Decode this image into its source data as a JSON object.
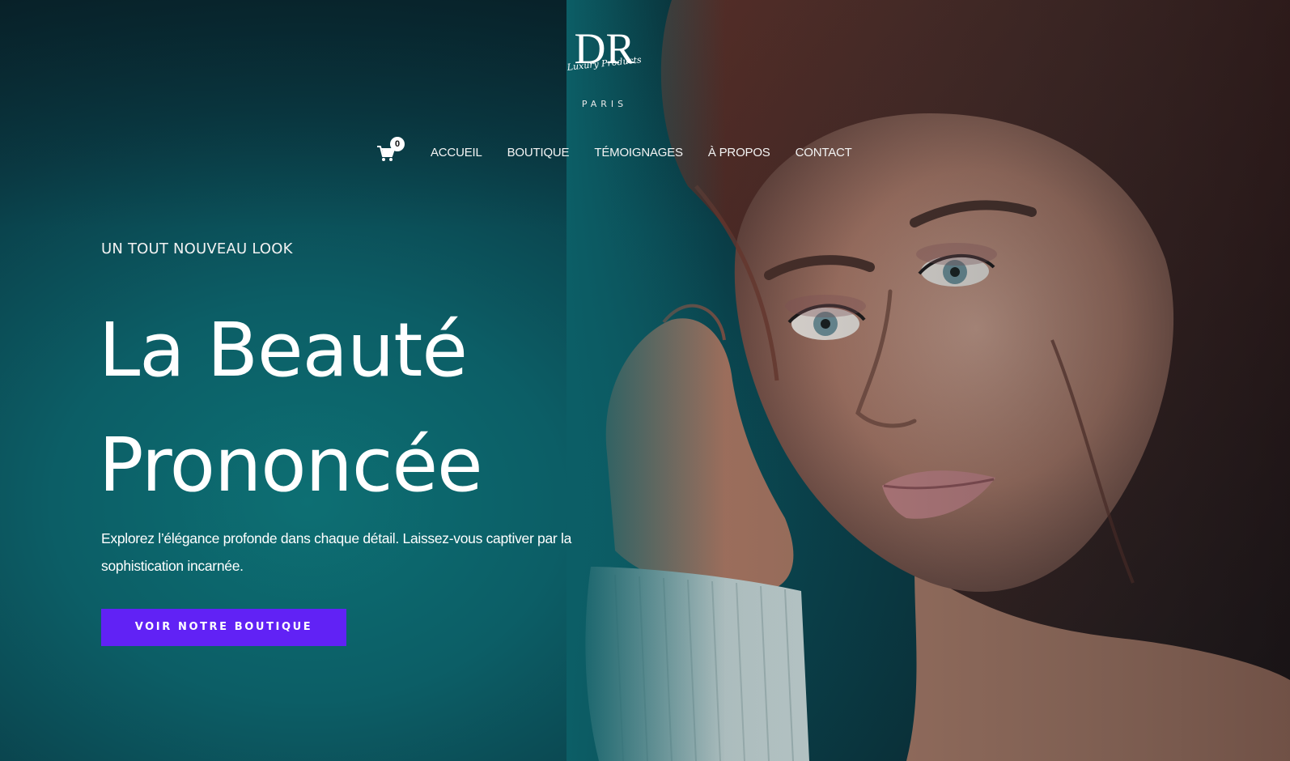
{
  "brand": {
    "monogram": "DR",
    "script_tagline": "Luxury Products",
    "city": "PARIS"
  },
  "header": {
    "cart": {
      "icon": "shopping-cart-icon",
      "count": "0"
    },
    "nav": [
      {
        "label": "ACCUEIL"
      },
      {
        "label": "BOUTIQUE"
      },
      {
        "label": "TÉMOIGNAGES"
      },
      {
        "label": "À PROPOS"
      },
      {
        "label": "CONTACT"
      }
    ]
  },
  "hero": {
    "eyebrow": "UN TOUT NOUVEAU LOOK",
    "headline_line1": "La Beauté",
    "headline_line2": "Prononcée",
    "lead": "Explorez l’élégance profonde dans chaque détail. Laissez-vous captiver par la sophistication incarnée.",
    "cta_label": "VOIR NOTRE BOUTIQUE"
  },
  "colors": {
    "background_teal": "#0c5e66",
    "cta_purple": "#6122f5",
    "text_white": "#ffffff"
  }
}
